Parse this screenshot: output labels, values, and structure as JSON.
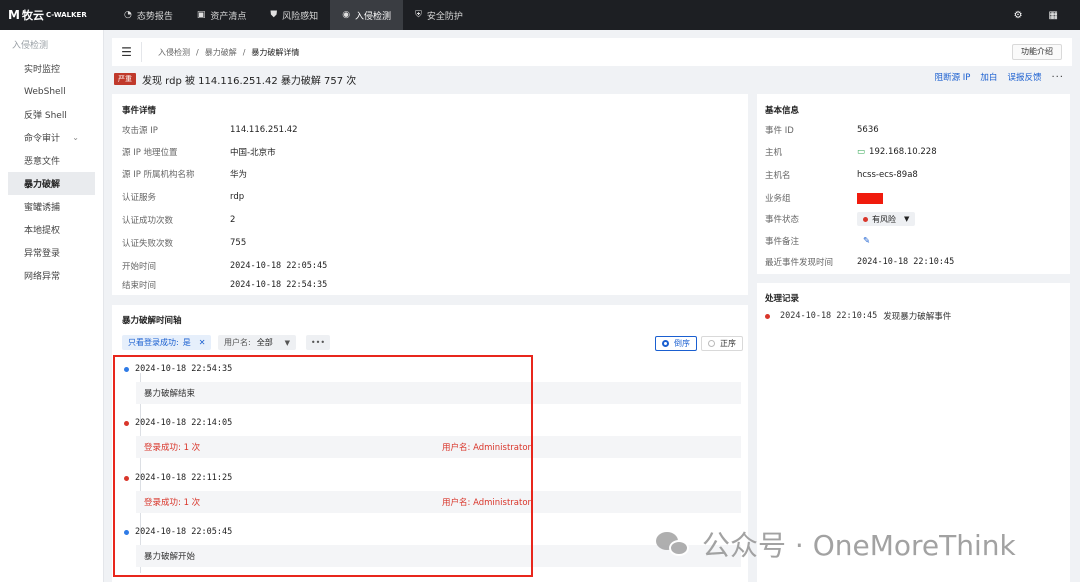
{
  "app": {
    "logo_mark": "M",
    "logo_text": "牧云",
    "logo_sub": "C-WALKER"
  },
  "nav": [
    {
      "label": "态势报告",
      "icon": "dashboard-icon"
    },
    {
      "label": "资产清点",
      "icon": "briefcase-icon"
    },
    {
      "label": "风险感知",
      "icon": "shield-alert-icon"
    },
    {
      "label": "入侵检测",
      "icon": "radar-icon"
    },
    {
      "label": "安全防护",
      "icon": "shield-check-icon"
    }
  ],
  "sidebar": {
    "title": "入侵检测",
    "items": [
      "实时监控",
      "WebShell",
      "反弹 Shell",
      "命令审计",
      "恶意文件",
      "暴力破解",
      "蜜罐诱捕",
      "本地提权",
      "异常登录",
      "网络异常"
    ]
  },
  "breadcrumb": [
    "入侵检测",
    "暴力破解",
    "暴力破解详情"
  ],
  "header": {
    "intro_btn": "功能介绍"
  },
  "event": {
    "severity": "严重",
    "title": "发现 rdp 被 114.116.251.42 暴力破解 757 次",
    "actions": [
      "阻断源 IP",
      "加白",
      "误报反馈",
      "···"
    ]
  },
  "details": {
    "title": "事件详情",
    "rows": [
      {
        "k": "攻击源 IP",
        "v": "114.116.251.42"
      },
      {
        "k": "源 IP 地理位置",
        "v": "中国-北京市"
      },
      {
        "k": "源 IP 所属机构名称",
        "v": "华为"
      },
      {
        "k": "认证服务",
        "v": "rdp"
      },
      {
        "k": "认证成功次数",
        "v": "2"
      },
      {
        "k": "认证失败次数",
        "v": "755"
      },
      {
        "k": "开始时间",
        "v": "2024-10-18 22:05:45"
      },
      {
        "k": "结束时间",
        "v": "2024-10-18 22:54:35"
      }
    ]
  },
  "basic": {
    "title": "基本信息",
    "event_id_k": "事件 ID",
    "event_id_v": "5636",
    "host_k": "主机",
    "host_v": "192.168.10.228",
    "hostname_k": "主机名",
    "hostname_v": "hcss-ecs-89a8",
    "group_k": "业务组",
    "status_k": "事件状态",
    "status_v": "有风险",
    "note_k": "事件备注",
    "last_k": "最近事件发现时间",
    "last_v": "2024-10-18 22:10:45"
  },
  "records": {
    "title": "处理记录",
    "items": [
      {
        "time": "2024-10-18 22:10:45",
        "text": "发现暴力破解事件"
      }
    ]
  },
  "timeline": {
    "title": "暴力破解时间轴",
    "filter_label": "只看登录成功:",
    "filter_value": "是",
    "user_filter_label": "用户名:",
    "user_filter_value": "全部",
    "more": "•••",
    "sort_desc": "倒序",
    "sort_asc": "正序",
    "entries": [
      {
        "time": "2024-10-18 22:54:35",
        "text": "暴力破解结束",
        "color": "#2f7be6"
      },
      {
        "time": "2024-10-18 22:14:05",
        "text": "登录成功: 1 次",
        "user": "用户名: Administrator",
        "color": "#d9362b"
      },
      {
        "time": "2024-10-18 22:11:25",
        "text": "登录成功: 1 次",
        "user": "用户名: Administrator",
        "color": "#d9362b"
      },
      {
        "time": "2024-10-18 22:05:45",
        "text": "暴力破解开始",
        "color": "#2f7be6"
      }
    ]
  },
  "watermark": "公众号 · OneMoreThink"
}
